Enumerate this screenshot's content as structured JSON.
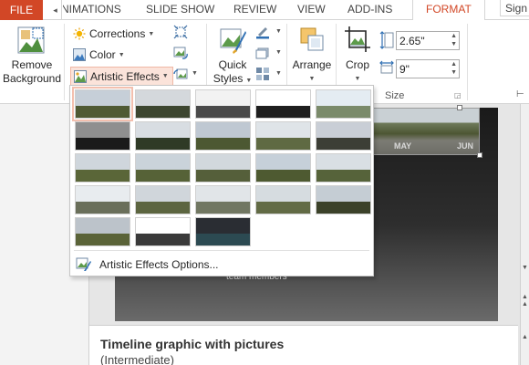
{
  "tabs": {
    "file": "FILE",
    "scroll_left": "◂",
    "animations": "ANIMATIONS",
    "slideshow": "SLIDE SHOW",
    "review": "REVIEW",
    "view": "VIEW",
    "addins": "ADD-INS",
    "format": "FORMAT",
    "signin": "Sign in"
  },
  "ribbon": {
    "remove_background_line1": "Remove",
    "remove_background_line2": "Background",
    "corrections": "Corrections",
    "color": "Color",
    "artistic_effects": "Artistic Effects",
    "quick_styles_line1": "Quick",
    "quick_styles_line2": "Styles",
    "arrange": "Arrange",
    "crop": "Crop",
    "height_value": "2.65\"",
    "width_value": "9\"",
    "size_group_label": "Size"
  },
  "slide": {
    "month_may": "MAY",
    "month_jun": "JUN",
    "team_members": "team members"
  },
  "notes": {
    "title": "Timeline graphic with pictures",
    "subtitle": "(Intermediate)"
  },
  "gallery": {
    "options_label": "Artistic Effects Options...",
    "effects": [
      {
        "id": "none",
        "sky": "#c6cfd8",
        "land": "#4f5a34"
      },
      {
        "id": "marker",
        "sky": "#d4d8dc",
        "land": "#3d4630"
      },
      {
        "id": "pencil-grayscale",
        "sky": "#f2f2f2",
        "land": "#4a4a4a"
      },
      {
        "id": "pencil-sketch",
        "sky": "#ffffff",
        "land": "#1e1e1e"
      },
      {
        "id": "line-drawing",
        "sky": "#e4ecf2",
        "land": "#7a8a6a"
      },
      {
        "id": "chalk-sketch",
        "sky": "#8f8f8f",
        "land": "#1a1a1a"
      },
      {
        "id": "paint-strokes",
        "sky": "#d8dde2",
        "land": "#2f3a26"
      },
      {
        "id": "paint-brush",
        "sky": "#bfc8d2",
        "land": "#4c5832"
      },
      {
        "id": "glow-diffused",
        "sky": "#dfe4e8",
        "land": "#5f6a43"
      },
      {
        "id": "blur",
        "sky": "#c9ced6",
        "land": "#3c3e36"
      },
      {
        "id": "light-screen",
        "sky": "#cfd6dc",
        "land": "#5a6638"
      },
      {
        "id": "watercolor-sponge",
        "sky": "#cad3da",
        "land": "#566237"
      },
      {
        "id": "film-grain",
        "sky": "#d2d8dd",
        "land": "#555f3a"
      },
      {
        "id": "mosaic-bubbles",
        "sky": "#c6d0d9",
        "land": "#4e5a31"
      },
      {
        "id": "glass",
        "sky": "#d9dfe4",
        "land": "#56633a"
      },
      {
        "id": "cement",
        "sky": "#e8ecef",
        "land": "#6a6f5a"
      },
      {
        "id": "texturizer",
        "sky": "#d0d6db",
        "land": "#5c6540"
      },
      {
        "id": "crisscross-etching",
        "sky": "#e1e5e8",
        "land": "#717762"
      },
      {
        "id": "pastels-smooth",
        "sky": "#d6dce0",
        "land": "#626b45"
      },
      {
        "id": "plastic-wrap",
        "sky": "#c5cdd4",
        "land": "#3b4129"
      },
      {
        "id": "cutout",
        "sky": "#bcc3ca",
        "land": "#5a6338"
      },
      {
        "id": "photocopy",
        "sky": "#ffffff",
        "land": "#3a3a3a"
      },
      {
        "id": "glow-edges",
        "sky": "#2a2d33",
        "land": "#2c4a52"
      }
    ]
  }
}
